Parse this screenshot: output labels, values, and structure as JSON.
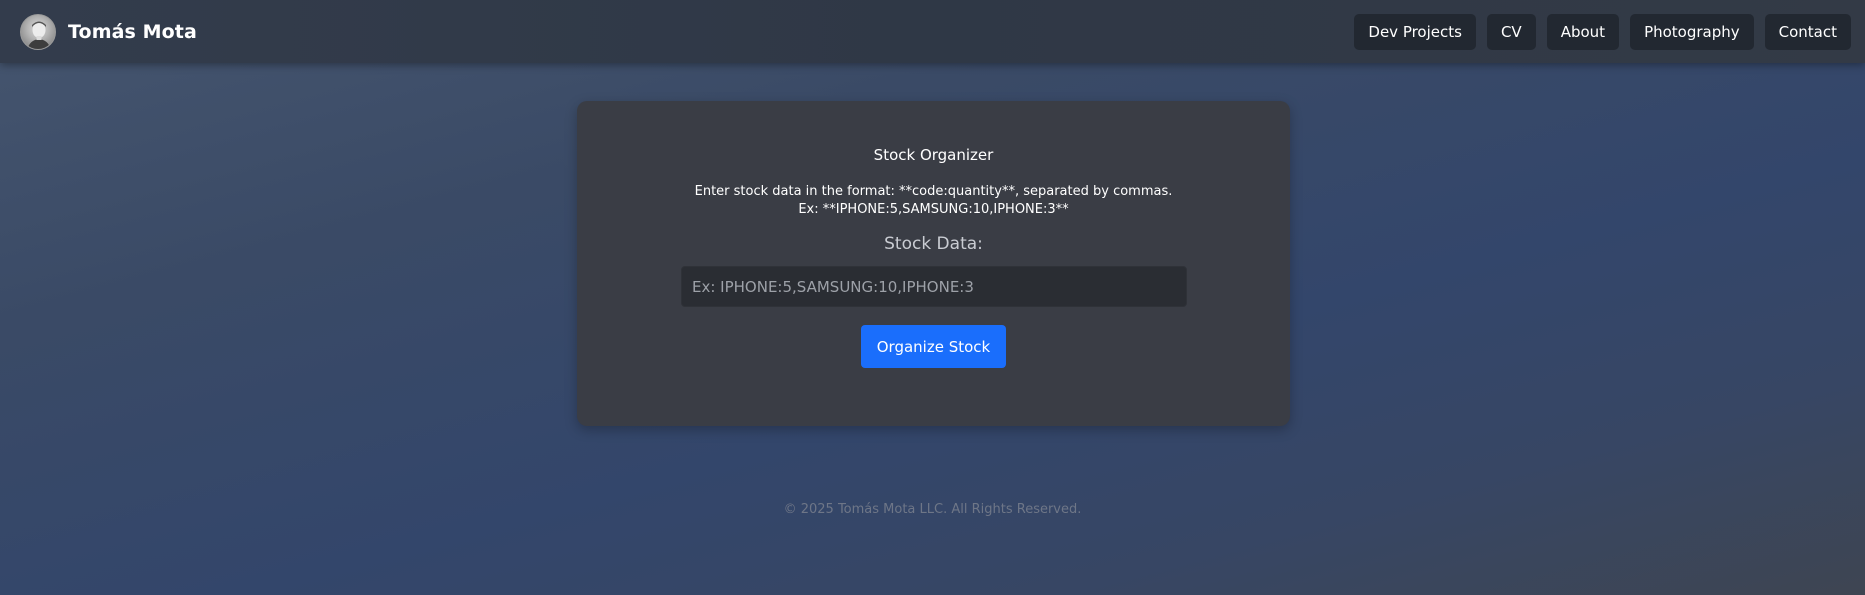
{
  "header": {
    "brand_name": "Tomás Mota",
    "nav_items": [
      {
        "label": "Dev Projects"
      },
      {
        "label": "CV"
      },
      {
        "label": "About"
      },
      {
        "label": "Photography"
      },
      {
        "label": "Contact"
      }
    ]
  },
  "main": {
    "title": "Stock Organizer",
    "instruction_line1": "Enter stock data in the format: **code:quantity**, separated by commas.",
    "instruction_line2": "Ex: **IPHONE:5,SAMSUNG:10,IPHONE:3**",
    "field_label": "Stock Data:",
    "input": {
      "value": "",
      "placeholder": "Ex: IPHONE:5,SAMSUNG:10,IPHONE:3"
    },
    "submit_label": "Organize Stock"
  },
  "footer": {
    "copyright": "© 2025 Tomás Mota LLC. All Rights Reserved."
  },
  "colors": {
    "accent": "#1a6efc",
    "nav_button_bg": "#222831",
    "card_bg": "#3a3d45"
  }
}
